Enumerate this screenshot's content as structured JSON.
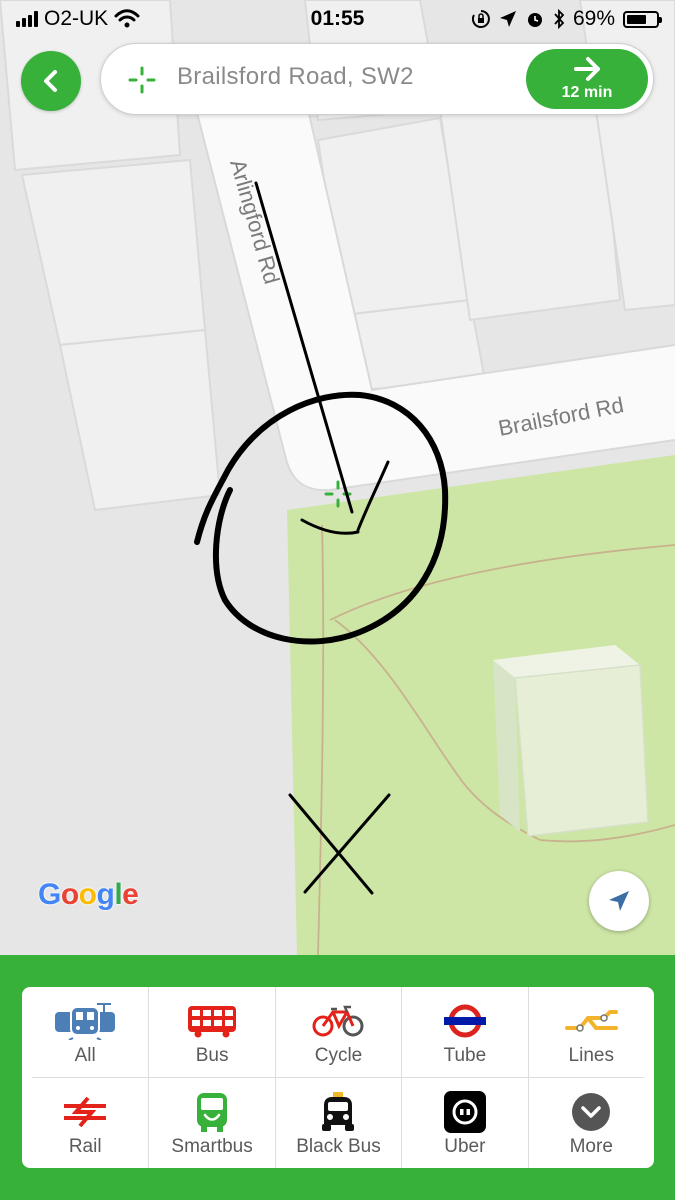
{
  "status_bar": {
    "carrier": "O2-UK",
    "time": "01:55",
    "battery_percent": "69%",
    "battery_level": 0.69,
    "icons": [
      "signal-icon",
      "wifi-icon",
      "orientation-lock-icon",
      "location-arrow-icon",
      "alarm-icon",
      "bluetooth-icon",
      "battery-icon"
    ]
  },
  "search": {
    "address": "Brailsford Road, SW2",
    "route_minutes": "12 min"
  },
  "map": {
    "streets": [
      "Arlingford Rd",
      "Brailsford Rd"
    ],
    "attribution": "Google",
    "colors": {
      "land": "#e6e6e6",
      "park": "#cde6a5",
      "road": "#fafafa",
      "accent": "#37b13a"
    }
  },
  "modes": {
    "row1": [
      {
        "label": "All",
        "icon": "transport-all-icon"
      },
      {
        "label": "Bus",
        "icon": "bus-icon"
      },
      {
        "label": "Cycle",
        "icon": "bicycle-icon"
      },
      {
        "label": "Tube",
        "icon": "tube-roundel-icon"
      },
      {
        "label": "Lines",
        "icon": "lines-icon"
      }
    ],
    "row2": [
      {
        "label": "Rail",
        "icon": "national-rail-icon"
      },
      {
        "label": "Smartbus",
        "icon": "smartbus-icon"
      },
      {
        "label": "Black Bus",
        "icon": "black-cab-icon"
      },
      {
        "label": "Uber",
        "icon": "uber-icon"
      },
      {
        "label": "More",
        "icon": "more-chevron-icon"
      }
    ]
  }
}
